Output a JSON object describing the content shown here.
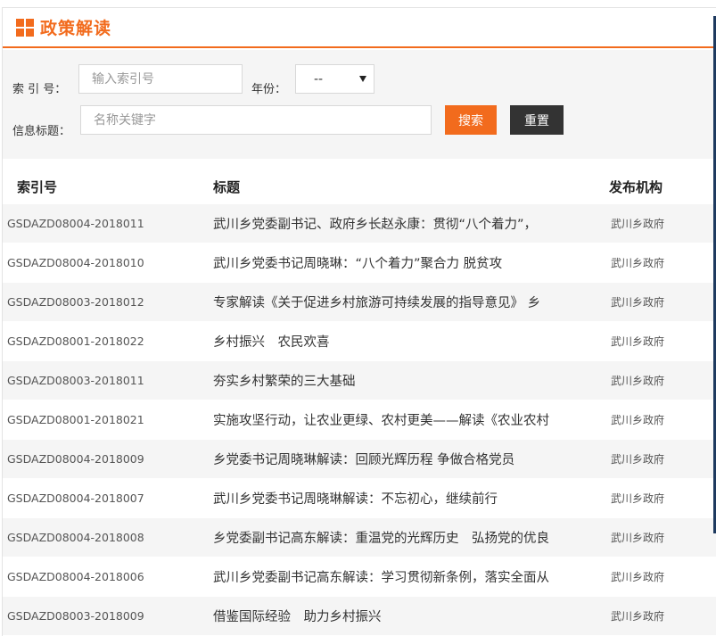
{
  "header": {
    "title": "政策解读",
    "icon": "grid-icon",
    "accent": "#f26b1d"
  },
  "filters": {
    "index_label": "索 引 号：",
    "index_placeholder": "输入索引号",
    "year_label": "年份：",
    "year_value": "--",
    "title_label": "信息标题：",
    "title_placeholder": "名称关键字",
    "search_label": "搜索",
    "reset_label": "重置"
  },
  "table": {
    "columns": [
      "索引号",
      "标题",
      "发布机构"
    ],
    "rows": [
      {
        "index": "GSDAZD08004-2018011",
        "title": "武川乡党委副书记、政府乡长赵永康：贯彻“八个着力”，",
        "org": "武川乡政府"
      },
      {
        "index": "GSDAZD08004-2018010",
        "title": "武川乡党委书记周晓琳：“八个着力”聚合力 脱贫攻",
        "org": "武川乡政府"
      },
      {
        "index": "GSDAZD08003-2018012",
        "title": "专家解读《关于促进乡村旅游可持续发展的指导意见》 乡",
        "org": "武川乡政府"
      },
      {
        "index": "GSDAZD08001-2018022",
        "title": "乡村振兴　农民欢喜",
        "org": "武川乡政府"
      },
      {
        "index": "GSDAZD08003-2018011",
        "title": "夯实乡村繁荣的三大基础",
        "org": "武川乡政府"
      },
      {
        "index": "GSDAZD08001-2018021",
        "title": "实施攻坚行动，让农业更绿、农村更美——解读《农业农村",
        "org": "武川乡政府"
      },
      {
        "index": "GSDAZD08004-2018009",
        "title": "乡党委书记周晓琳解读：回顾光辉历程 争做合格党员",
        "org": "武川乡政府"
      },
      {
        "index": "GSDAZD08004-2018007",
        "title": "武川乡党委书记周晓琳解读：不忘初心，继续前行",
        "org": "武川乡政府"
      },
      {
        "index": "GSDAZD08004-2018008",
        "title": "乡党委副书记高东解读：重温党的光辉历史　弘扬党的优良",
        "org": "武川乡政府"
      },
      {
        "index": "GSDAZD08004-2018006",
        "title": "武川乡党委副书记高东解读：学习贯彻新条例，落实全面从",
        "org": "武川乡政府"
      },
      {
        "index": "GSDAZD08003-2018009",
        "title": "借鉴国际经验　助力乡村振兴",
        "org": "武川乡政府"
      }
    ]
  }
}
